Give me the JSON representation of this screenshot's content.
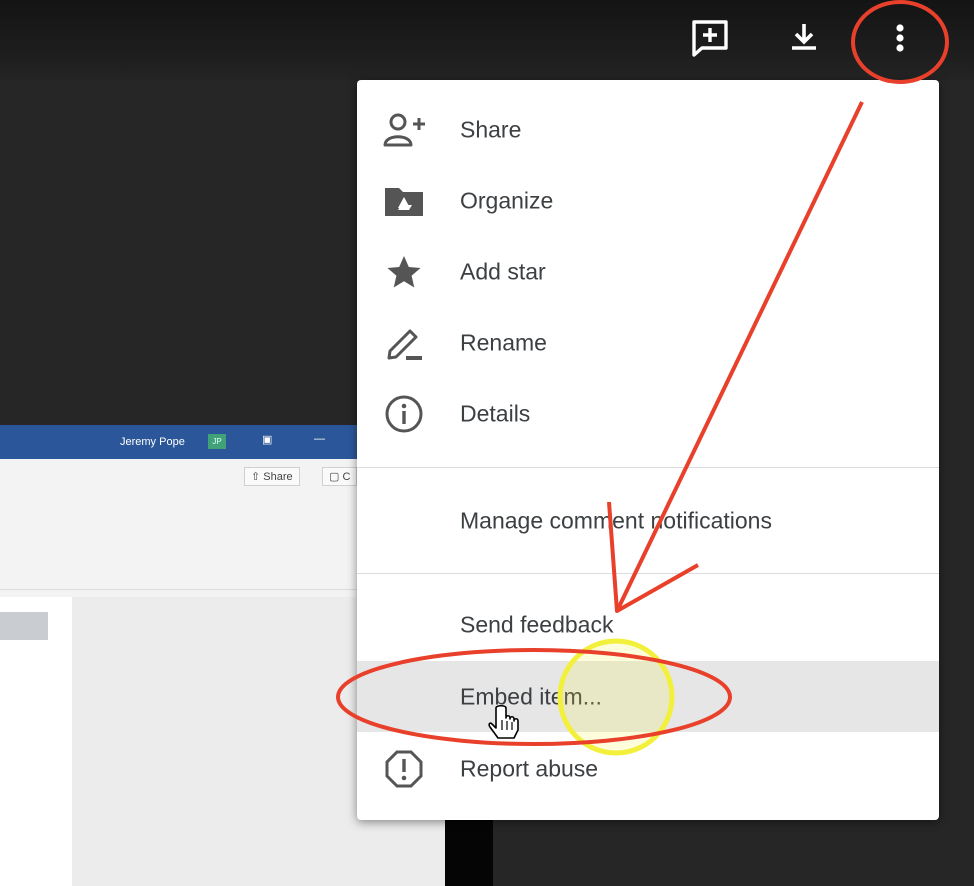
{
  "toolbar": {
    "icons": [
      "add-comment-icon",
      "download-icon",
      "more-vert-icon"
    ]
  },
  "embedded_app": {
    "user_name": "Jeremy Pope",
    "user_initials": "JP",
    "share_label": "Share",
    "comment_label": "C"
  },
  "menu": {
    "items": [
      {
        "label": "Share",
        "icon": "person-add-icon"
      },
      {
        "label": "Organize",
        "icon": "drive-folder-icon"
      },
      {
        "label": "Add star",
        "icon": "star-icon"
      },
      {
        "label": "Rename",
        "icon": "pencil-icon"
      },
      {
        "label": "Details",
        "icon": "info-icon"
      },
      {
        "label": "Manage comment notifications"
      },
      {
        "label": "Send feedback"
      },
      {
        "label": "Embed item..."
      },
      {
        "label": "Report abuse",
        "icon": "report-icon"
      }
    ],
    "highlighted_item": "Embed item..."
  },
  "colors": {
    "annotation_red": "#e8402a",
    "cursor_highlight_yellow": "#f2f03a",
    "menu_text": "#3c4043",
    "highlight_bg": "#e6e6e6"
  }
}
